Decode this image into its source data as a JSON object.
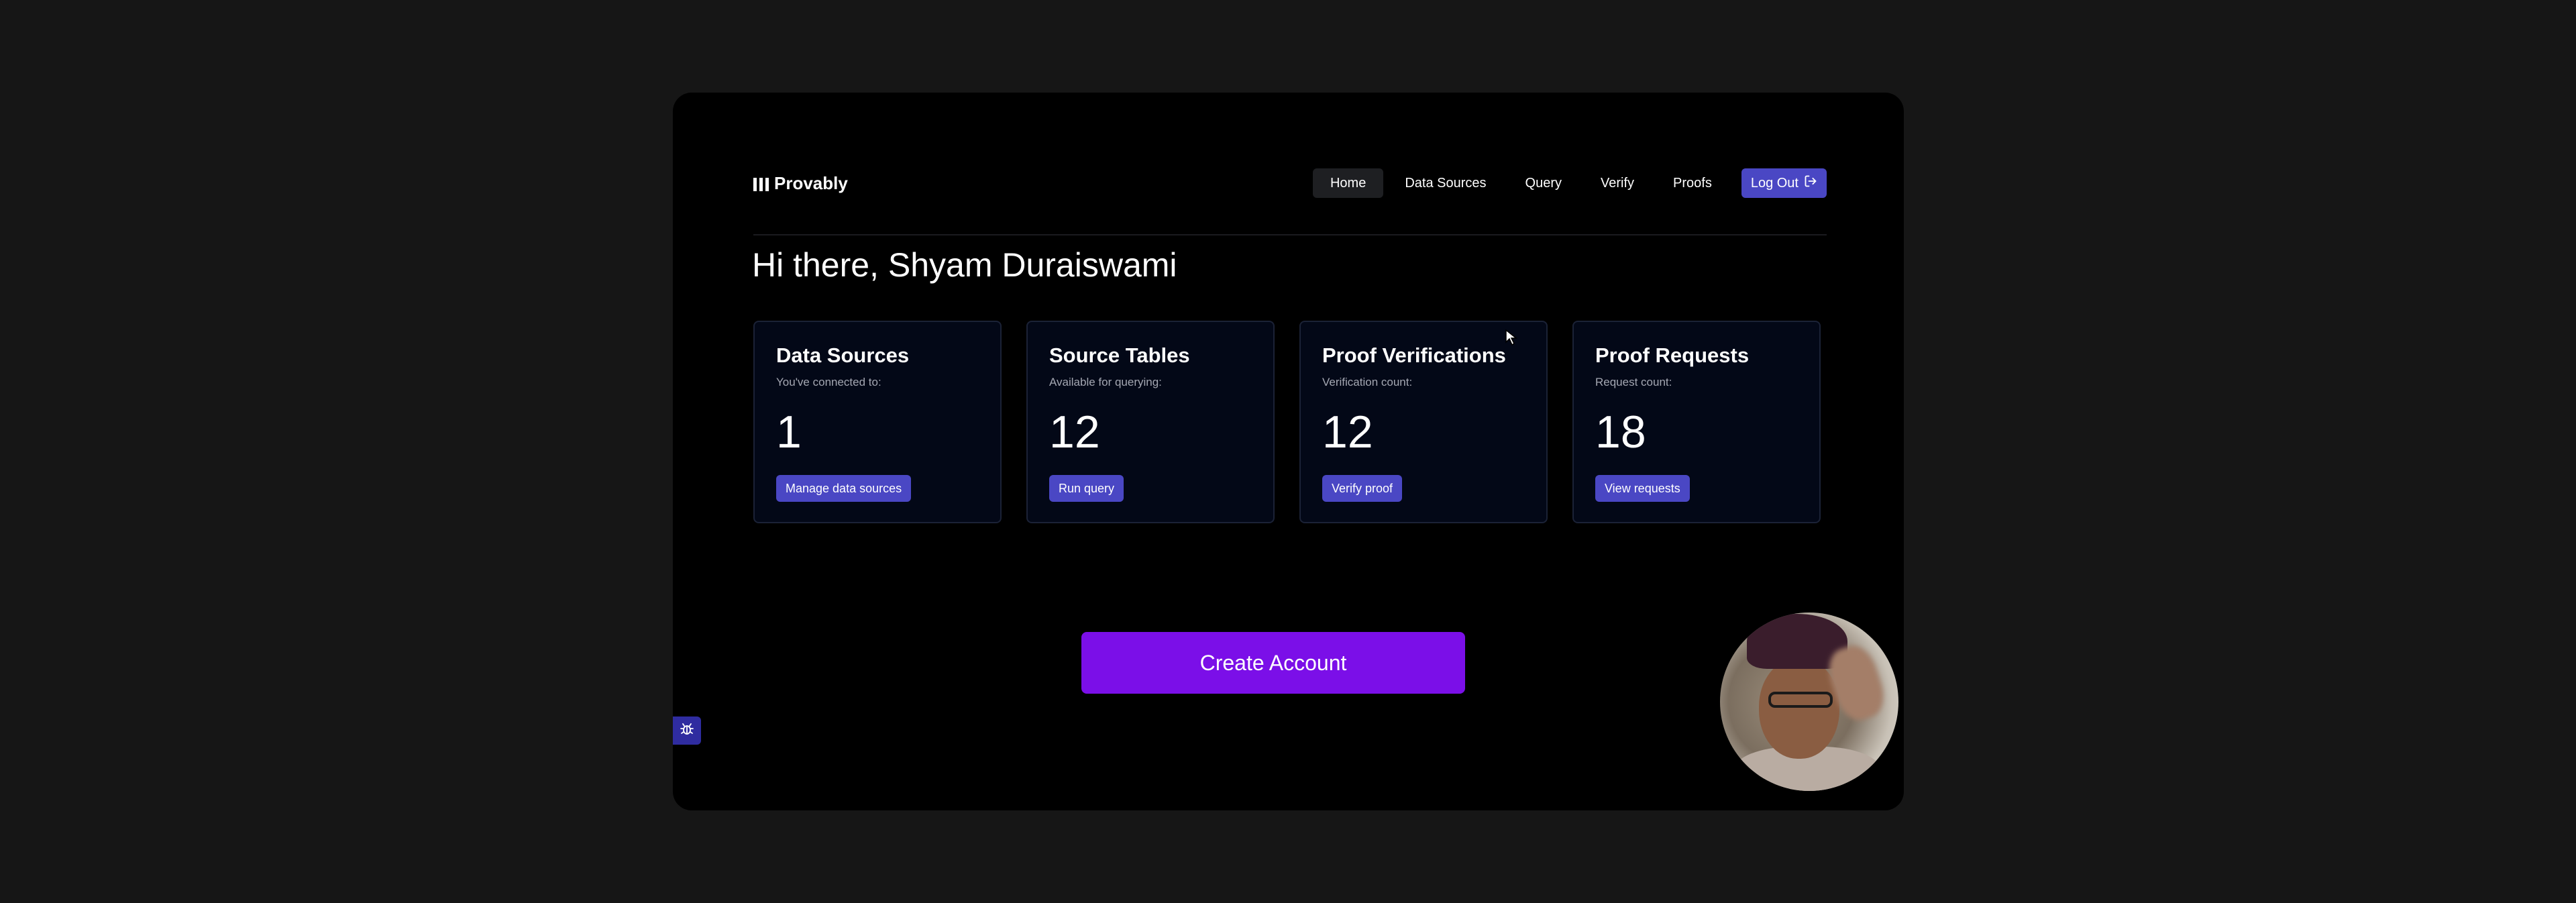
{
  "brand": {
    "name": "Provably"
  },
  "nav": {
    "items": [
      {
        "label": "Home",
        "active": true
      },
      {
        "label": "Data Sources",
        "active": false
      },
      {
        "label": "Query",
        "active": false
      },
      {
        "label": "Verify",
        "active": false
      },
      {
        "label": "Proofs",
        "active": false
      }
    ],
    "logout_label": "Log Out"
  },
  "greeting": "Hi there, Shyam Duraiswami",
  "cards": [
    {
      "title": "Data Sources",
      "subtitle": "You've connected to:",
      "value": "1",
      "button": "Manage data sources"
    },
    {
      "title": "Source Tables",
      "subtitle": "Available for querying:",
      "value": "12",
      "button": "Run query"
    },
    {
      "title": "Proof Verifications",
      "subtitle": "Verification count:",
      "value": "12",
      "button": "Verify proof"
    },
    {
      "title": "Proof Requests",
      "subtitle": "Request count:",
      "value": "18",
      "button": "View requests"
    }
  ],
  "create_account_label": "Create Account",
  "icons": {
    "logo": "provably-logo-icon",
    "logout": "logout-icon",
    "debug": "bug-icon"
  },
  "colors": {
    "accent": "#4a47c4",
    "primary_cta": "#7b0fe8",
    "card_bg": "#030817"
  }
}
